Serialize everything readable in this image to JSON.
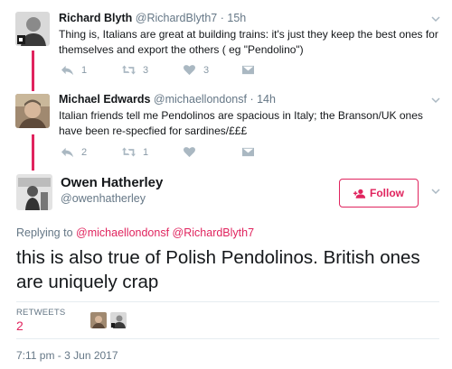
{
  "thread": [
    {
      "name": "Richard Blyth",
      "handle": "@RichardBlyth7",
      "separator": "·",
      "time": "15h",
      "text": "Thing is, Italians are great at building trains: it's just they keep the best ones for themselves and export the others ( eg \"Pendolino\")",
      "replies": "1",
      "retweets": "3",
      "likes": "3",
      "avatar_icon": "avatar-photo"
    },
    {
      "name": "Michael Edwards",
      "handle": "@michaellondonsf",
      "separator": "·",
      "time": "14h",
      "text": "Italian friends tell me Pendolinos are spacious in Italy; the Branson/UK ones have been re-specfied for sardines/£££",
      "replies": "2",
      "retweets": "1",
      "likes": "",
      "avatar_icon": "avatar-photo"
    }
  ],
  "main": {
    "name": "Owen Hatherley",
    "handle": "@owenhatherley",
    "follow_label": "Follow",
    "replying_prefix": "Replying to",
    "replying_to_1": "@michaellondonsf",
    "replying_to_2": "@RichardBlyth7",
    "text": "this is also true of Polish Pendolinos. British ones are uniquely crap",
    "retweets_label": "RETWEETS",
    "retweets_count": "2",
    "timestamp": "7:11 pm - 3 Jun 2017"
  },
  "colors": {
    "accent": "#e0245e",
    "muted": "#657786",
    "icon": "#aab8c2"
  }
}
